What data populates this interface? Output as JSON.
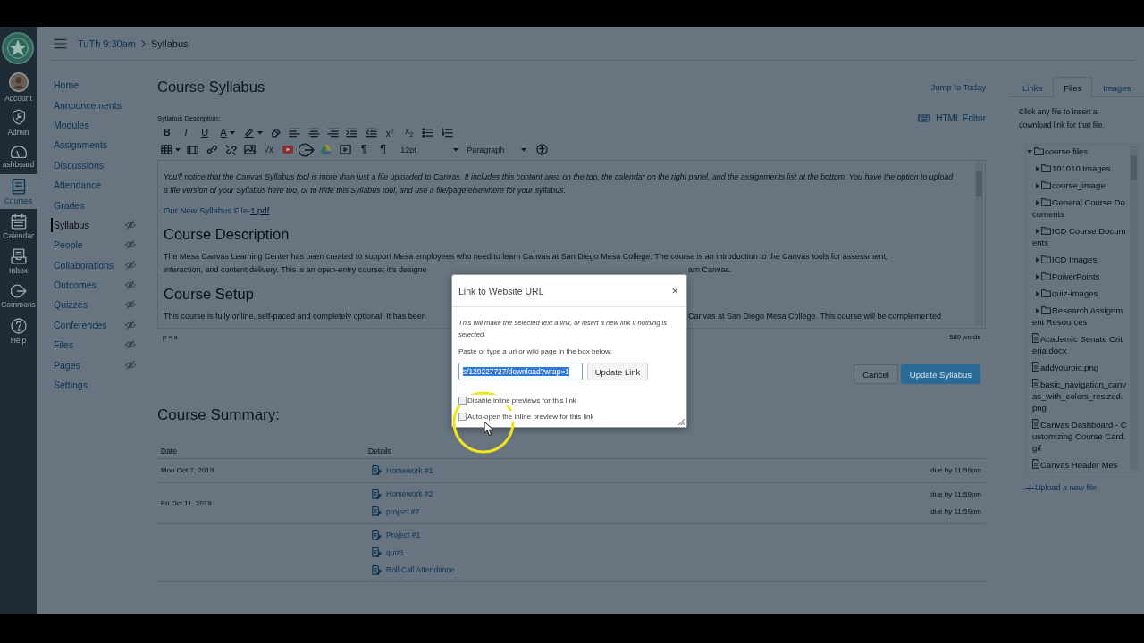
{
  "global_nav": {
    "items": [
      {
        "label": "Account",
        "selected": false
      },
      {
        "label": "Admin",
        "selected": false
      },
      {
        "label": "ashboard",
        "selected": false
      },
      {
        "label": "Courses",
        "selected": true
      },
      {
        "label": "Calendar",
        "selected": false
      },
      {
        "label": "Inbox",
        "selected": false
      },
      {
        "label": "Commons",
        "selected": false
      },
      {
        "label": "Help",
        "selected": false
      }
    ]
  },
  "header": {
    "breadcrumbs": [
      "TuTh 9:30am",
      "Syllabus"
    ]
  },
  "course_nav": {
    "items": [
      {
        "label": "Home",
        "selected": false,
        "hidden": false
      },
      {
        "label": "Announcements",
        "selected": false,
        "hidden": false
      },
      {
        "label": "Modules",
        "selected": false,
        "hidden": false
      },
      {
        "label": "Assignments",
        "selected": false,
        "hidden": false
      },
      {
        "label": "Discussions",
        "selected": false,
        "hidden": false
      },
      {
        "label": "Attendance",
        "selected": false,
        "hidden": false
      },
      {
        "label": "Grades",
        "selected": false,
        "hidden": false
      },
      {
        "label": "Syllabus",
        "selected": true,
        "hidden": true
      },
      {
        "label": "People",
        "selected": false,
        "hidden": true
      },
      {
        "label": "Collaborations",
        "selected": false,
        "hidden": true
      },
      {
        "label": "Outcomes",
        "selected": false,
        "hidden": true
      },
      {
        "label": "Quizzes",
        "selected": false,
        "hidden": true
      },
      {
        "label": "Conferences",
        "selected": false,
        "hidden": true
      },
      {
        "label": "Files",
        "selected": false,
        "hidden": true
      },
      {
        "label": "Pages",
        "selected": false,
        "hidden": true
      },
      {
        "label": "Settings",
        "selected": false,
        "hidden": false
      }
    ]
  },
  "syllabus": {
    "title": "Course Syllabus",
    "jump_link": "Jump to Today",
    "description_label": "Syllabus Description:",
    "html_editor_link": "HTML Editor",
    "toolbar": {
      "glyph_buttons": [
        "B",
        "I",
        "U",
        "A",
        "x$^{2}$",
        "x$_{2}$",
        "√x",
        "¶",
        "¶"
      ],
      "font_size": "12pt",
      "block_format": "Paragraph"
    },
    "editor": {
      "intro": "You'll notice that the Canvas Syllabus tool is more than just a file uploaded to Canvas. It includes this content area on the top, the calendar on the right panel, and the assignments list at the bottom. You have the option to upload a file version of your Syllabus here too, or to hide this Syllabus tool, and use a file/page elsewhere for your syllabus.",
      "file_link": {
        "text": "Our New Syllabus File-",
        "selected_part": "1.pdf"
      },
      "sections": [
        {
          "heading": "Course Description",
          "lines": [
            {
              "text": "The Mesa Canvas Learning Center has been created to support Mesa employees who need to learn Canvas at San Diego Mesa College. The course is an introduction to the Canvas tools for assessment,"
            },
            {
              "text": "interaction, and content delivery. This is an open-entry course; it's designe",
              "text_right": "arn Canvas."
            }
          ]
        },
        {
          "heading": "Course Setup",
          "lines": [
            {
              "text": "This course is fully online, self-paced and completely optional. It has been",
              "text_right": "Canvas at San Diego Mesa College. This course will be complemented"
            }
          ]
        }
      ]
    },
    "element_path": "p » a",
    "word_count": "589 words",
    "buttons": [
      {
        "label": "Cancel",
        "kind": "secondary"
      },
      {
        "label": "Update Syllabus",
        "kind": "primary"
      }
    ]
  },
  "course_summary": {
    "title": "Course Summary:",
    "columns": [
      "Date",
      "Details"
    ],
    "groups": [
      {
        "date": "Mon Oct 7, 2019",
        "items": [
          {
            "title": "Homework #1",
            "due": "due by 11:59pm"
          }
        ]
      },
      {
        "date": "Fri Oct 11, 2019",
        "items": [
          {
            "title": "Homework #2",
            "due": "due by 11:59pm"
          },
          {
            "title": "project #2",
            "due": "due by 11:59pm"
          }
        ]
      },
      {
        "items": [
          {
            "title": "Project #1"
          },
          {
            "title": "quiz1"
          },
          {
            "title": "Roll Call Attendance"
          }
        ]
      }
    ]
  },
  "content_panel": {
    "tabs": [
      {
        "label": "Links",
        "selected": false
      },
      {
        "label": "Files",
        "selected": true
      },
      {
        "label": "Images",
        "selected": false
      }
    ],
    "hint": "Click any file to insert a download link for that file.",
    "tree": [
      {
        "label": "course files",
        "kind": "folder",
        "expanded": true,
        "children": [
          {
            "label": "101010 Images",
            "kind": "folder",
            "expanded": false
          },
          {
            "label": "course_image",
            "kind": "folder",
            "expanded": false
          },
          {
            "label": "General Course Documents",
            "kind": "folder",
            "expanded": false
          },
          {
            "label": "ICD Course Documents",
            "kind": "folder",
            "expanded": false
          },
          {
            "label": "ICD Images",
            "kind": "folder",
            "expanded": false
          },
          {
            "label": "PowerPoints",
            "kind": "folder",
            "expanded": false
          },
          {
            "label": "quiz-images",
            "kind": "folder",
            "expanded": false
          },
          {
            "label": "Research Assignment Resources",
            "kind": "folder",
            "expanded": false
          },
          {
            "label": "Academic Senate Criteria.docx",
            "kind": "file"
          },
          {
            "label": "addyourpic.png",
            "kind": "file"
          },
          {
            "label": "basic_navigation_canvas_with_colors_resized.png",
            "kind": "file"
          },
          {
            "label": "Canvas Dashboard - Customizing Course Card.gif",
            "kind": "file"
          },
          {
            "label": "Canvas Header Mes",
            "kind": "file"
          }
        ]
      }
    ],
    "upload_link": "Upload a new file"
  },
  "dialog": {
    "title": "Link to Website URL",
    "close": "×",
    "description": "This will make the selected text a link, or insert a new link if nothing is selected.",
    "prompt": "Paste or type a url or wiki page in the box below:",
    "url": {
      "value": "s/129227727/download?wrap=1",
      "text_selected": true
    },
    "submit": "Update Link",
    "options": [
      {
        "label": "Disable inline previews for this link",
        "checked": false
      },
      {
        "label": "Auto-open the inline preview for this link",
        "checked": false
      }
    ]
  }
}
